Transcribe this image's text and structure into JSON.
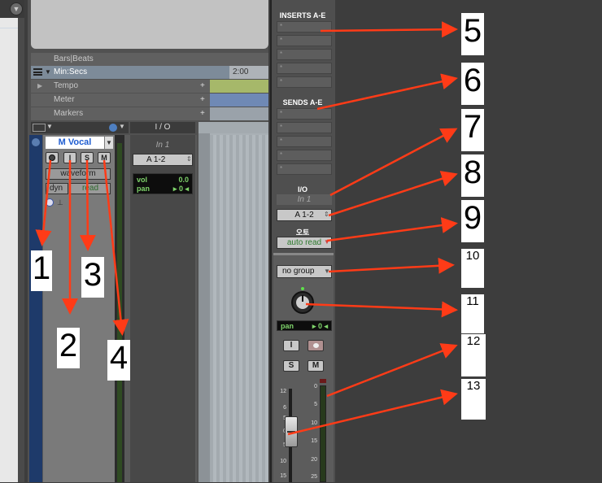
{
  "colors": {
    "arrow": "#ff3b17",
    "accent_blue": "#1f5dd1",
    "meter_green": "#7fd46b"
  },
  "rulers": {
    "bars_beats": "Bars|Beats",
    "min_secs": "Min:Secs",
    "time_marker": "2:00",
    "tempo": "Tempo",
    "meter": "Meter",
    "markers": "Markers",
    "plus": "+",
    "tempo_color": "#a6b86a",
    "meter_color": "#6f89b5",
    "markers_color": "#9aa2aa"
  },
  "io_header": "I / O",
  "track": {
    "name": "M Vocal",
    "rec_icon": "record-icon",
    "in_label": "I",
    "solo_label": "S",
    "mute_label": "M",
    "view": "waveform",
    "dyn_label": "dyn",
    "automation": "read",
    "input": "In 1",
    "output": "A 1-2",
    "vol_label": "vol",
    "vol_value": "0.0",
    "pan_label": "pan",
    "pan_value": "0"
  },
  "mix": {
    "inserts_label": "INSERTS A-E",
    "sends_label": "SENDS A-E",
    "slot_star": "*",
    "io_label": "I/O",
    "input": "In 1",
    "output": "A 1-2",
    "automation_icon_label": "오토",
    "automation": "auto read",
    "group": "no group",
    "pan_label": "pan",
    "pan_value": "0",
    "in_label": "I",
    "solo_label": "S",
    "mute_label": "M",
    "fader_scale": [
      "12",
      "6",
      "5",
      "0",
      "5",
      "10",
      "15"
    ],
    "meter_scale": [
      "0",
      "5",
      "10",
      "15",
      "20",
      "25"
    ]
  },
  "callouts": [
    "1",
    "2",
    "3",
    "4",
    "5",
    "6",
    "7",
    "8",
    "9",
    "10",
    "11",
    "12",
    "13"
  ]
}
